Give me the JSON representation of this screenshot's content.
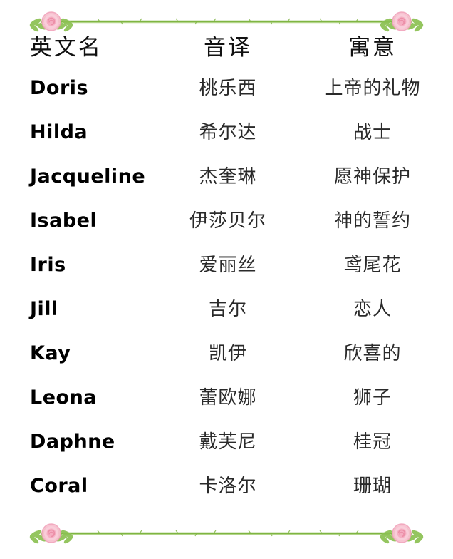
{
  "decoration": {
    "top_divider": "rose-vine-divider",
    "bottom_divider": "rose-vine-divider",
    "rose_color": "#f4a7bb",
    "rose_core_color": "#fbd4de",
    "leaf_color": "#8cc152",
    "vine_color": "#7fb542"
  },
  "table": {
    "headers": {
      "name": "英文名",
      "transliteration": "音译",
      "meaning": "寓意"
    },
    "rows": [
      {
        "name": "Doris",
        "transliteration": "桃乐西",
        "meaning": "上帝的礼物"
      },
      {
        "name": "Hilda",
        "transliteration": "希尔达",
        "meaning": "战士"
      },
      {
        "name": "Jacqueline",
        "transliteration": "杰奎琳",
        "meaning": "愿神保护"
      },
      {
        "name": "Isabel",
        "transliteration": "伊莎贝尔",
        "meaning": "神的誓约"
      },
      {
        "name": "Iris",
        "transliteration": "爱丽丝",
        "meaning": "鸢尾花"
      },
      {
        "name": "Jill",
        "transliteration": "吉尔",
        "meaning": "恋人"
      },
      {
        "name": "Kay",
        "transliteration": "凯伊",
        "meaning": "欣喜的"
      },
      {
        "name": "Leona",
        "transliteration": "蕾欧娜",
        "meaning": "狮子"
      },
      {
        "name": "Daphne",
        "transliteration": "戴芙尼",
        "meaning": "桂冠"
      },
      {
        "name": "Coral",
        "transliteration": "卡洛尔",
        "meaning": "珊瑚"
      }
    ]
  }
}
